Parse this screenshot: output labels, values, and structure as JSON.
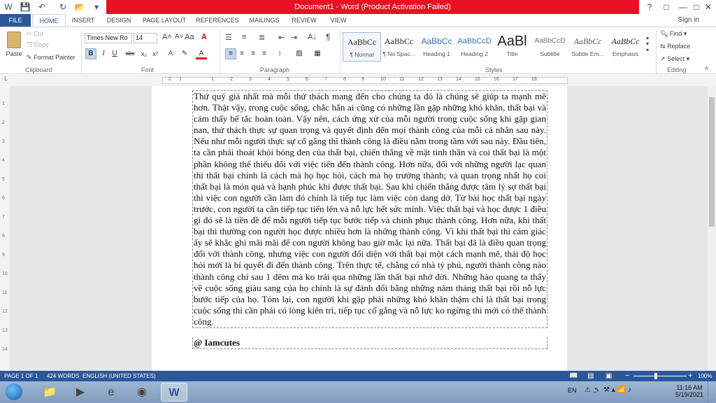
{
  "title": "Document1 - Word (Product Activation Failed)",
  "window_controls": [
    "?",
    "□",
    "—",
    "□",
    "✕"
  ],
  "tabs": [
    "FILE",
    "HOME",
    "INSERT",
    "DESIGN",
    "PAGE LAYOUT",
    "REFERENCES",
    "MAILINGS",
    "REVIEW",
    "VIEW"
  ],
  "sign_in": "Sign in",
  "clipboard": {
    "paste": "Paste",
    "cut": "Cut",
    "copy": "Copy",
    "format_painter": "Format Painter",
    "label": "Clipboard"
  },
  "font": {
    "name": "Times New Ro",
    "size": "14",
    "label": "Font"
  },
  "paragraph": {
    "label": "Paragraph"
  },
  "styles": {
    "label": "Styles",
    "items": [
      {
        "preview": "AaBbCc",
        "name": "¶ Normal"
      },
      {
        "preview": "AaBbCc",
        "name": "¶ No Spac..."
      },
      {
        "preview": "AaBbCc",
        "name": "Heading 1"
      },
      {
        "preview": "AaBbCcD",
        "name": "Heading 2"
      },
      {
        "preview": "AaBl",
        "name": "Title"
      },
      {
        "preview": "AaBbCcD",
        "name": "Subtitle"
      },
      {
        "preview": "AaBbCc",
        "name": "Subtle Em..."
      },
      {
        "preview": "AaBbCc",
        "name": "Emphasis"
      }
    ]
  },
  "editing": {
    "find": "Find",
    "replace": "Replace",
    "select": "Select",
    "label": "Editing"
  },
  "document": {
    "body": "Thứ quý giá nhất mà mỗi thử thách mang đến cho chúng ta đó là chúng sẽ giúp ta mạnh mẽ hơn. Thật vậy, trong cuộc sống, chắc hẳn ai cũng có những lần gặp những khó khăn, thất bại và cảm thấy bế tắc hoàn toàn. Vậy nên, cách ứng xử của mỗi người trong cuộc sống khi gặp gian nan, thử thách thực sự quan trọng và quyết định đến mọi thành công của mỗi cá nhân sau này. Nếu như mỗi người thực sự cố gắng thì thành công là điều nằm trong tầm với sau này. Đầu tiên, ta cần phải thoát khỏi bóng đen của thất bại, chiến thắng về mặt tinh thần và coi thất bại là một phần không thể thiếu đối với việc tiến đến thành công. Hơn nữa, đối với những người lạc quan thì thất bại chính là cách mà họ học hỏi, cách mà họ trưởng thành; và quan trọng nhất họ coi thất bại là món quà và hạnh phúc khi được thất bại. Sau khi chiến thắng được tâm lý sợ thất bại thì việc con người cần làm đó chính là tiếp tục làm việc còn dang dở. Từ bài học thất bại ngày trước, con người ta cần tiếp tục tiến lên và nỗ lực hết sức mình. Việc thất bại và học được 1 điều gì đó sẽ là tiền đề để mỗi người tiếp tục bước tiếp và chinh phục thành công. Hơn nữa, khi thất bại thì thường con người học được nhiều hơn là những thành công. Vì khi thất bại thì cảm giác ấy sẽ khắc ghi mãi mãi để con người không bao giờ mắc lại nữa. Thất bại đã là điều quan trọng đối với thành công, nhưng việc con người đối diện với thất bại một cách mạnh mẽ, thái độ học hỏi mới là bí quyết đi đến thành công. Trên thực tế, chẳng có nhà tỷ phú, người thành công nào thành công chỉ sau 1 đêm mà ko trải qua những lần thất bại nhớ đời. Những hào quang ta thấy về cuộc sống giàu sang của họ chính là sự đánh đổi bằng những năm tháng thất bại rồi nỗ lực bước tiếp của họ. Tóm lại, con người khi gặp phải những khó khăn thậm chí là thất bại trong cuộc sống thì cần phải có lòng kiên trì, tiếp tục cố gắng và nỗ lực ko ngừng thì mới có thể thành công.",
    "signature": "@ Iamcutes"
  },
  "status_bar": {
    "page": "PAGE 1 OF 1",
    "words": "424 WORDS",
    "language": "ENGLISH (UNITED STATES)",
    "zoom": "100%"
  },
  "tray": {
    "lang": "EN",
    "time": "11:16 AM",
    "date": "5/19/2021"
  },
  "ruler_numbers": [
    "2",
    "1",
    "1",
    "2",
    "3",
    "4",
    "5",
    "6",
    "7",
    "8",
    "9",
    "10",
    "11",
    "12",
    "13",
    "14",
    "15",
    "16",
    "17",
    "18"
  ],
  "vruler_numbers": [
    "1",
    "2",
    "3",
    "4",
    "5",
    "6",
    "7",
    "8",
    "9",
    "10",
    "11",
    "12",
    "13",
    "14"
  ],
  "colors": {
    "word_blue": "#2b579a",
    "title_red": "#e81123"
  }
}
